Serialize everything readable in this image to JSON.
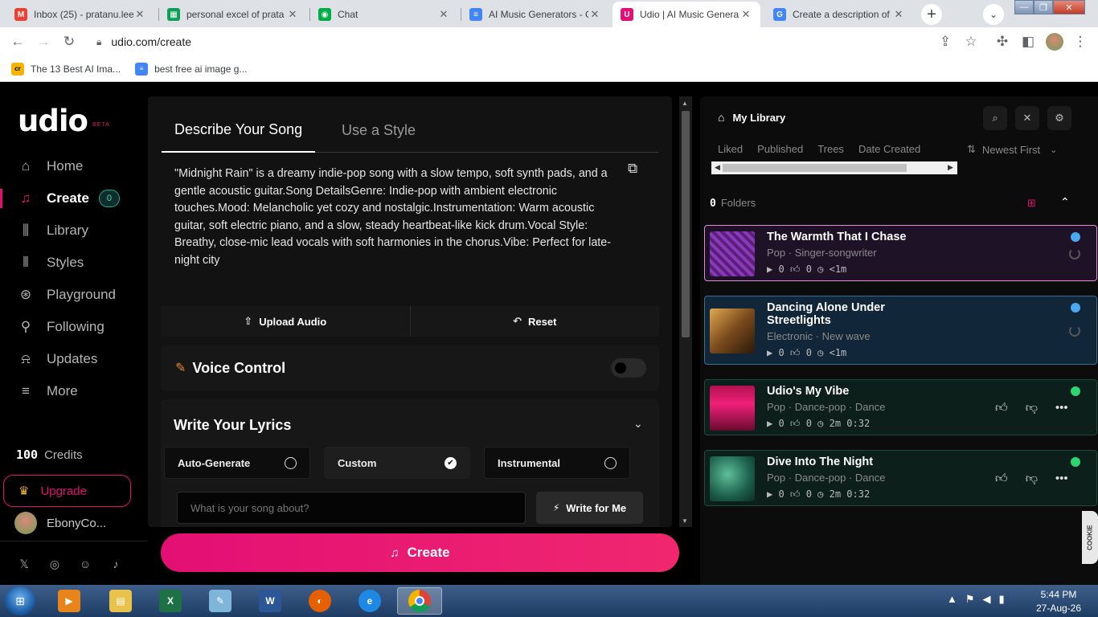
{
  "browser": {
    "tabs": [
      {
        "title": "Inbox (25) - pratanu.lee",
        "icon": "gmail-icon",
        "color": "#ea4335",
        "glyph": "M"
      },
      {
        "title": "personal excel of prata",
        "icon": "sheets-icon",
        "color": "#0f9d58",
        "glyph": "▦"
      },
      {
        "title": "Chat",
        "icon": "chat-icon",
        "color": "#00ac47",
        "glyph": "◉"
      },
      {
        "title": "AI Music Generators - G",
        "icon": "docs-icon",
        "color": "#4285f4",
        "glyph": "≡"
      },
      {
        "title": "Udio | AI Music Genera",
        "icon": "udio-icon",
        "color": "#e30f74",
        "glyph": "U"
      },
      {
        "title": "Create a description of",
        "icon": "google-icon",
        "color": "#4285f4",
        "glyph": "G"
      }
    ],
    "url": "udio.com/create",
    "bookmarks": [
      {
        "label": "The 13 Best AI Ima...",
        "icon": "cr-icon",
        "glyph": "cr",
        "color": "#f5b400"
      },
      {
        "label": "best free ai image g...",
        "icon": "docs-icon",
        "glyph": "≡",
        "color": "#4285f4"
      }
    ]
  },
  "sidebar": {
    "logo": "udio",
    "beta": "BETA",
    "nav": [
      {
        "label": "Home",
        "icon": "home-icon",
        "glyph": "⌂"
      },
      {
        "label": "Create",
        "icon": "music-note-icon",
        "glyph": "♫",
        "badge": "0"
      },
      {
        "label": "Library",
        "icon": "library-icon",
        "glyph": "⫼"
      },
      {
        "label": "Styles",
        "icon": "waveform-icon",
        "glyph": "⦀"
      },
      {
        "label": "Playground",
        "icon": "playground-icon",
        "glyph": "⊛"
      },
      {
        "label": "Following",
        "icon": "user-icon",
        "glyph": "⚲"
      },
      {
        "label": "Updates",
        "icon": "bell-icon",
        "glyph": "⍾"
      },
      {
        "label": "More",
        "icon": "menu-icon",
        "glyph": "≡"
      }
    ],
    "credits_value": "100",
    "credits_label": "Credits",
    "upgrade": "Upgrade",
    "username": "EbonyCo..."
  },
  "create": {
    "tab_describe": "Describe Your Song",
    "tab_style": "Use a Style",
    "description": "\"Midnight Rain\" is a dreamy indie-pop song with a slow tempo, soft synth pads, and a gentle acoustic guitar.Song DetailsGenre: Indie-pop with ambient electronic touches.Mood: Melancholic yet cozy and nostalgic.Instrumentation: Warm acoustic guitar, soft electric piano, and a slow, steady heartbeat-like kick drum.Vocal Style: Breathy, close-mic lead vocals with soft harmonies in the chorus.Vibe: Perfect for late-night city",
    "upload_audio": "Upload Audio",
    "reset": "Reset",
    "voice_control": "Voice Control",
    "voice_control_on": false,
    "write_lyrics": "Write Your Lyrics",
    "lyric_options": [
      {
        "label": "Auto-Generate",
        "selected": false
      },
      {
        "label": "Custom",
        "selected": true
      },
      {
        "label": "Instrumental",
        "selected": false
      }
    ],
    "song_placeholder": "What is your song about?",
    "write_for_me": "Write for Me",
    "create_button": "Create"
  },
  "library": {
    "title": "My Library",
    "filters": [
      "Liked",
      "Published",
      "Trees",
      "Date Created"
    ],
    "sort": "Newest First",
    "folders_count": "0",
    "folders_label": "Folders",
    "songs": [
      {
        "title": "The Warmth That I Chase",
        "tags": [
          "Pop",
          "Singer-songwriter"
        ],
        "plays": "0",
        "likes": "0",
        "duration": "<1m",
        "length": "",
        "status_color": "#4aa8f0",
        "generating": true,
        "highlight": "#e58adf",
        "bg": "#1d1226"
      },
      {
        "title": "Dancing Alone Under Streetlights",
        "tags": [
          "Electronic",
          "New wave"
        ],
        "plays": "0",
        "likes": "0",
        "duration": "<1m",
        "length": "",
        "status_color": "#4aa8f0",
        "generating": true,
        "highlight": "#3e6f8f",
        "bg": "#112638"
      },
      {
        "title": "Udio's My Vibe",
        "tags": [
          "Pop",
          "Dance-pop",
          "Dance"
        ],
        "plays": "0",
        "likes": "0",
        "duration": "2m",
        "length": "0:32",
        "status_color": "#2ed573",
        "generating": false,
        "highlight": "#1f4a3c",
        "bg": "#0c1f1a"
      },
      {
        "title": "Dive Into The Night",
        "tags": [
          "Pop",
          "Dance-pop",
          "Dance"
        ],
        "plays": "0",
        "likes": "0",
        "duration": "2m",
        "length": "0:32",
        "status_color": "#2ed573",
        "generating": false,
        "highlight": "#1f4a3c",
        "bg": "#0c1f1a"
      }
    ]
  },
  "cookie": "COOKIE",
  "taskbar": {
    "time": "5:44 PM",
    "date": "27-Aug-26"
  }
}
